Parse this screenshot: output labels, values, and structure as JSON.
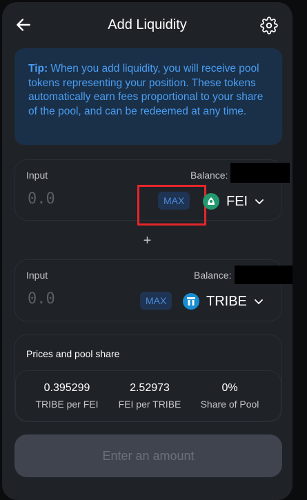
{
  "header": {
    "title": "Add Liquidity",
    "back_icon": "arrow-left-icon",
    "settings_icon": "gear-icon"
  },
  "tip": {
    "label": "Tip:",
    "text": " When you add liquidity, you will receive pool tokens representing your position. These tokens automatically earn fees proportional to your share of the pool, and can be redeemed at any time."
  },
  "input1": {
    "label": "Input",
    "balance_label": "Balance:",
    "placeholder": "0.0",
    "max_label": "MAX",
    "token": "FEI",
    "token_icon": "fei-token-icon",
    "token_color": "#22996e"
  },
  "plus": "+",
  "input2": {
    "label": "Input",
    "balance_label": "Balance:",
    "placeholder": "0.0",
    "max_label": "MAX",
    "token": "TRIBE",
    "token_icon": "tribe-token-icon",
    "token_color": "#178dd0"
  },
  "prices": {
    "title": "Prices and pool share",
    "stats": [
      {
        "value": "0.395299",
        "label": "TRIBE per FEI"
      },
      {
        "value": "2.52973",
        "label": "FEI per TRIBE"
      },
      {
        "value": "0%",
        "label": "Share of Pool"
      }
    ]
  },
  "action": {
    "label": "Enter an amount"
  },
  "colors": {
    "card_bg": "#1f2227",
    "tip_bg": "#1a3049",
    "tip_text": "#4a9ef3",
    "highlight": "#e6262b",
    "disabled_button": "#40444f"
  }
}
